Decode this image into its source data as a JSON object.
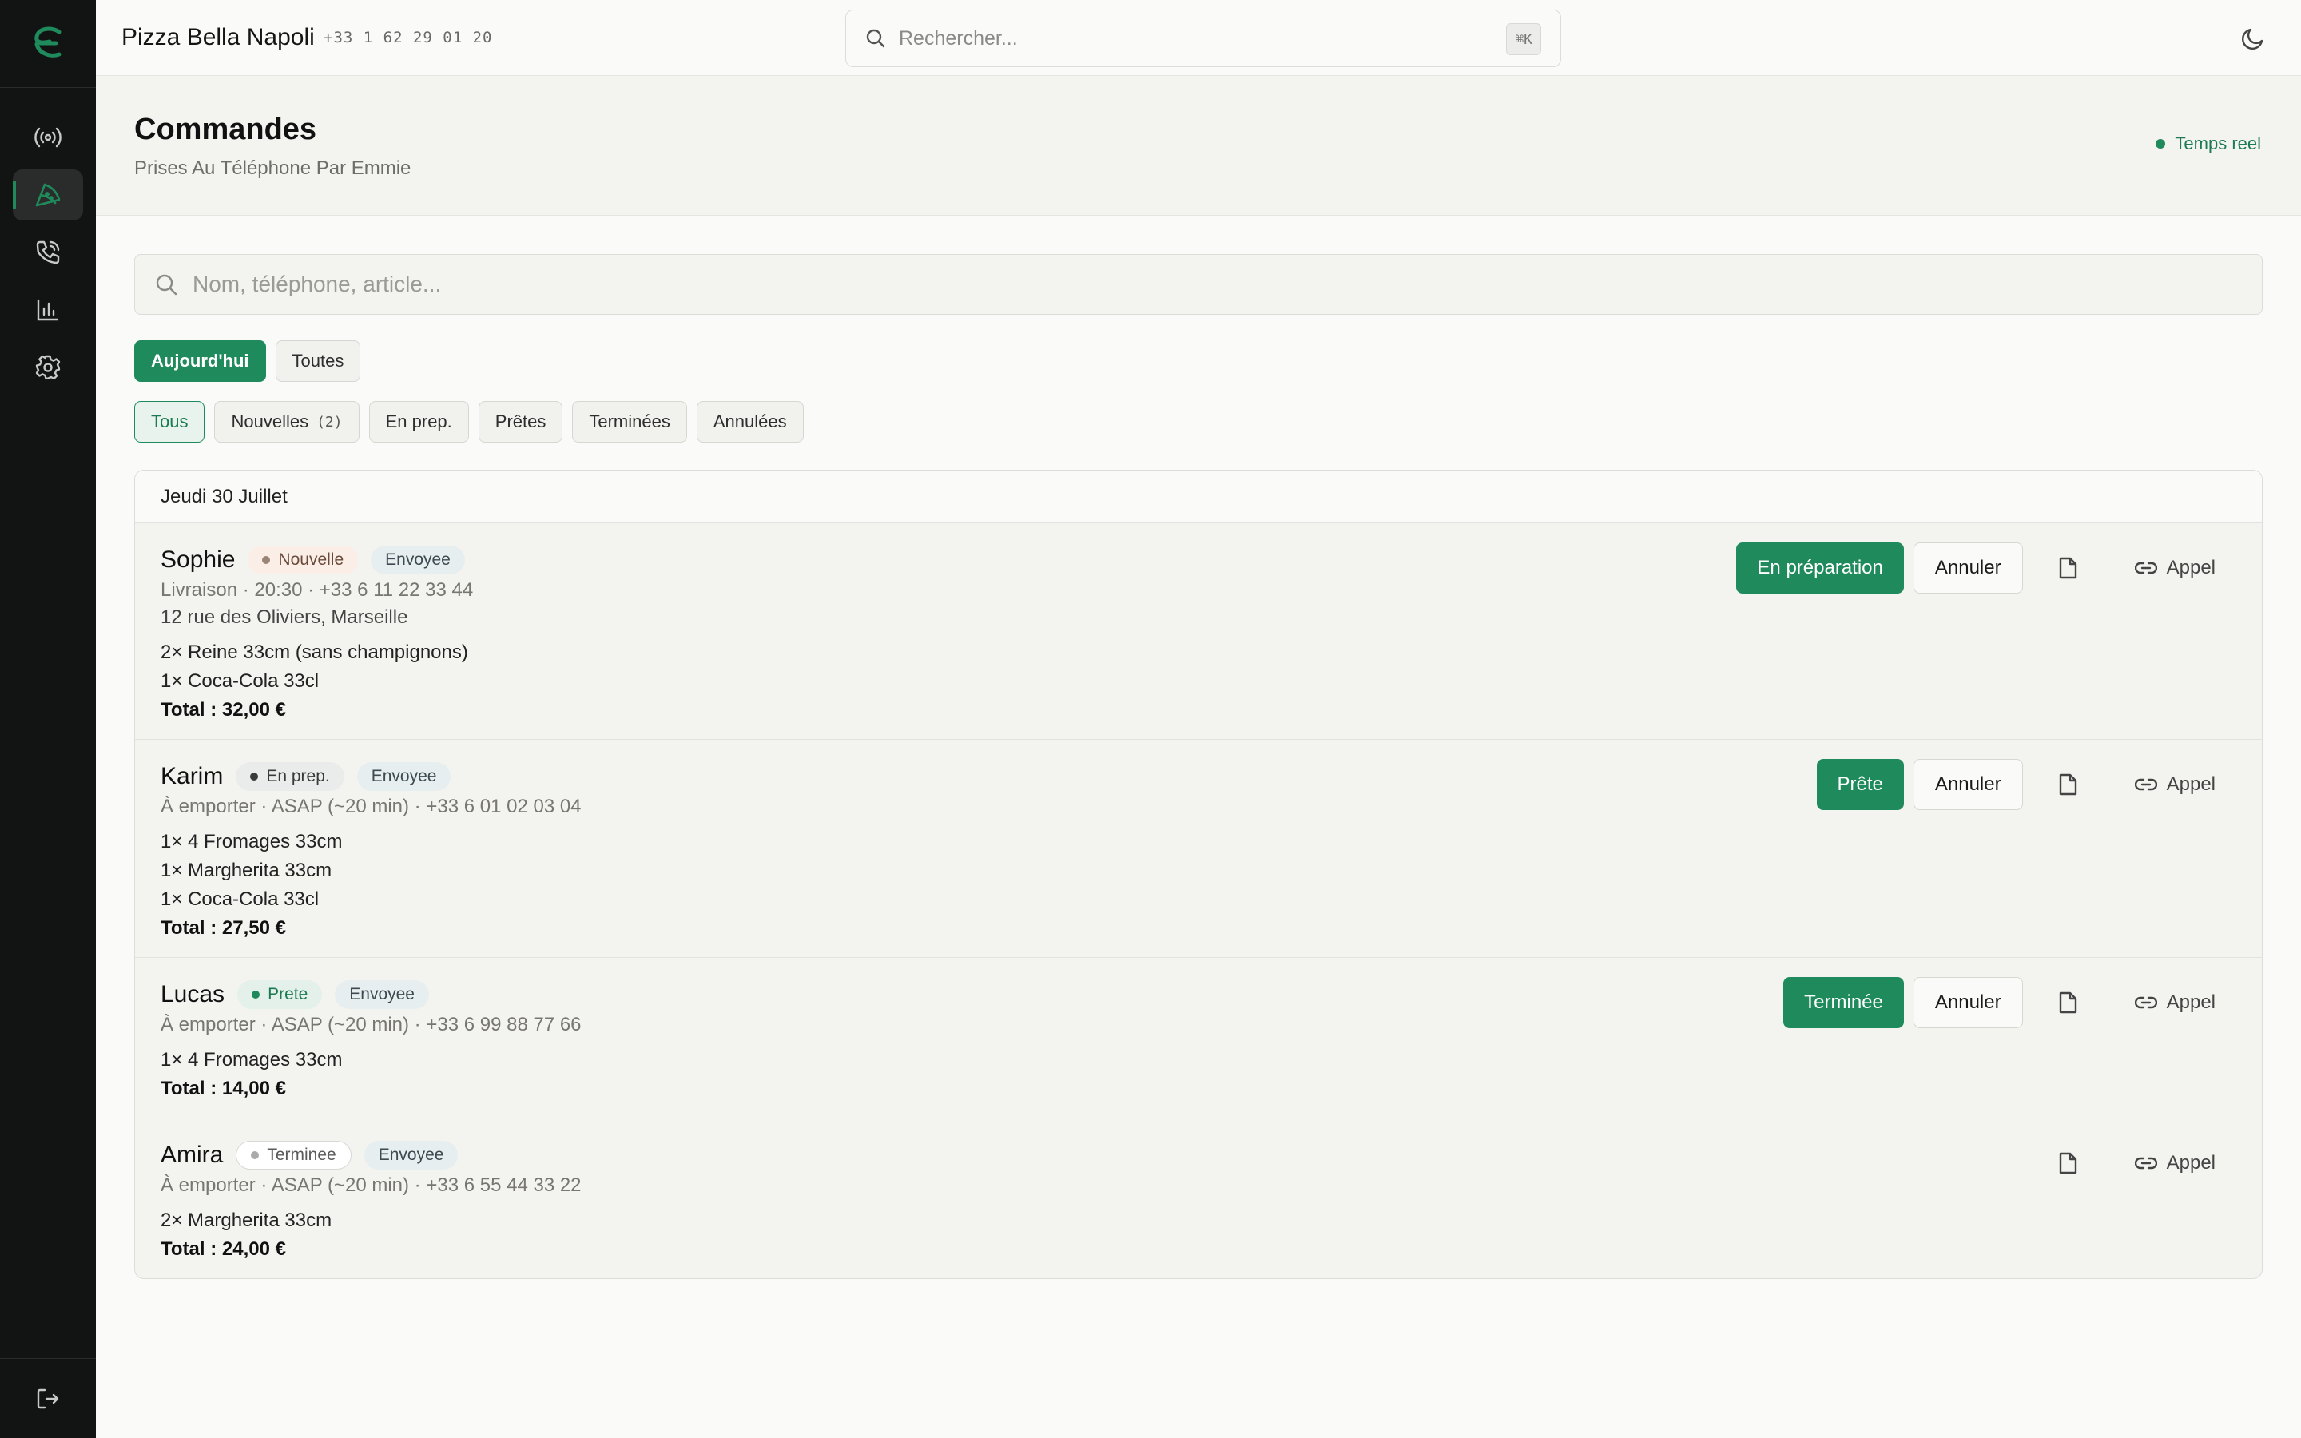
{
  "app": {
    "restaurant_name": "Pizza Bella Napoli",
    "restaurant_phone": "+33 1 62 29 01 20",
    "logo_icon": "emmie-logo-icon",
    "accent_color": "#1f8a5b"
  },
  "sidebar": {
    "items": [
      {
        "name": "live",
        "icon": "broadcast-icon"
      },
      {
        "name": "orders",
        "icon": "pizza-slice-icon",
        "active": true
      },
      {
        "name": "calls",
        "icon": "phone-icon"
      },
      {
        "name": "stats",
        "icon": "bar-chart-icon"
      },
      {
        "name": "settings",
        "icon": "gear-icon"
      }
    ],
    "logout_icon": "logout-icon"
  },
  "topbar": {
    "search_placeholder": "Rechercher...",
    "search_shortcut": "⌘K",
    "theme_icon": "moon-icon"
  },
  "header": {
    "title": "Commandes",
    "subtitle": "Prises Au Téléphone Par Emmie",
    "realtime_label": "Temps reel"
  },
  "filters": {
    "search_placeholder": "Nom, téléphone, article...",
    "period": [
      "Aujourd'hui",
      "Toutes"
    ],
    "period_selected": "Aujourd'hui",
    "status": [
      {
        "label": "Tous"
      },
      {
        "label": "Nouvelles",
        "count": "(2)"
      },
      {
        "label": "En prep."
      },
      {
        "label": "Prêtes"
      },
      {
        "label": "Terminées"
      },
      {
        "label": "Annulées"
      }
    ],
    "status_selected": "Tous"
  },
  "orders": {
    "day_label": "Jeudi 30 Juillet",
    "list": [
      {
        "name": "Sophie",
        "status": "Nouvelle",
        "sent": "Envoyee",
        "meta": "Livraison · 20:30 · +33 6 11 22 33 44",
        "address": "12 rue des Oliviers, Marseille",
        "items": [
          "2× Reine 33cm (sans champignons)",
          "1× Coca-Cola 33cl"
        ],
        "total": "Total : 32,00 €",
        "primary_action": "En préparation",
        "cancel": "Annuler",
        "call": "Appel"
      },
      {
        "name": "Karim",
        "status": "En prep.",
        "sent": "Envoyee",
        "meta": "À emporter · ASAP (~20 min) · +33 6 01 02 03 04",
        "items": [
          "1× 4 Fromages 33cm",
          "1× Margherita 33cm",
          "1× Coca-Cola 33cl"
        ],
        "total": "Total : 27,50 €",
        "primary_action": "Prête",
        "cancel": "Annuler",
        "call": "Appel"
      },
      {
        "name": "Lucas",
        "status": "Prete",
        "sent": "Envoyee",
        "meta": "À emporter · ASAP (~20 min) · +33 6 99 88 77 66",
        "items": [
          "1× 4 Fromages 33cm"
        ],
        "total": "Total : 14,00 €",
        "primary_action": "Terminée",
        "cancel": "Annuler",
        "call": "Appel"
      },
      {
        "name": "Amira",
        "status": "Terminee",
        "sent": "Envoyee",
        "meta": "À emporter · ASAP (~20 min) · +33 6 55 44 33 22",
        "items": [
          "2× Margherita 33cm"
        ],
        "total": "Total : 24,00 €",
        "call": "Appel"
      }
    ]
  }
}
